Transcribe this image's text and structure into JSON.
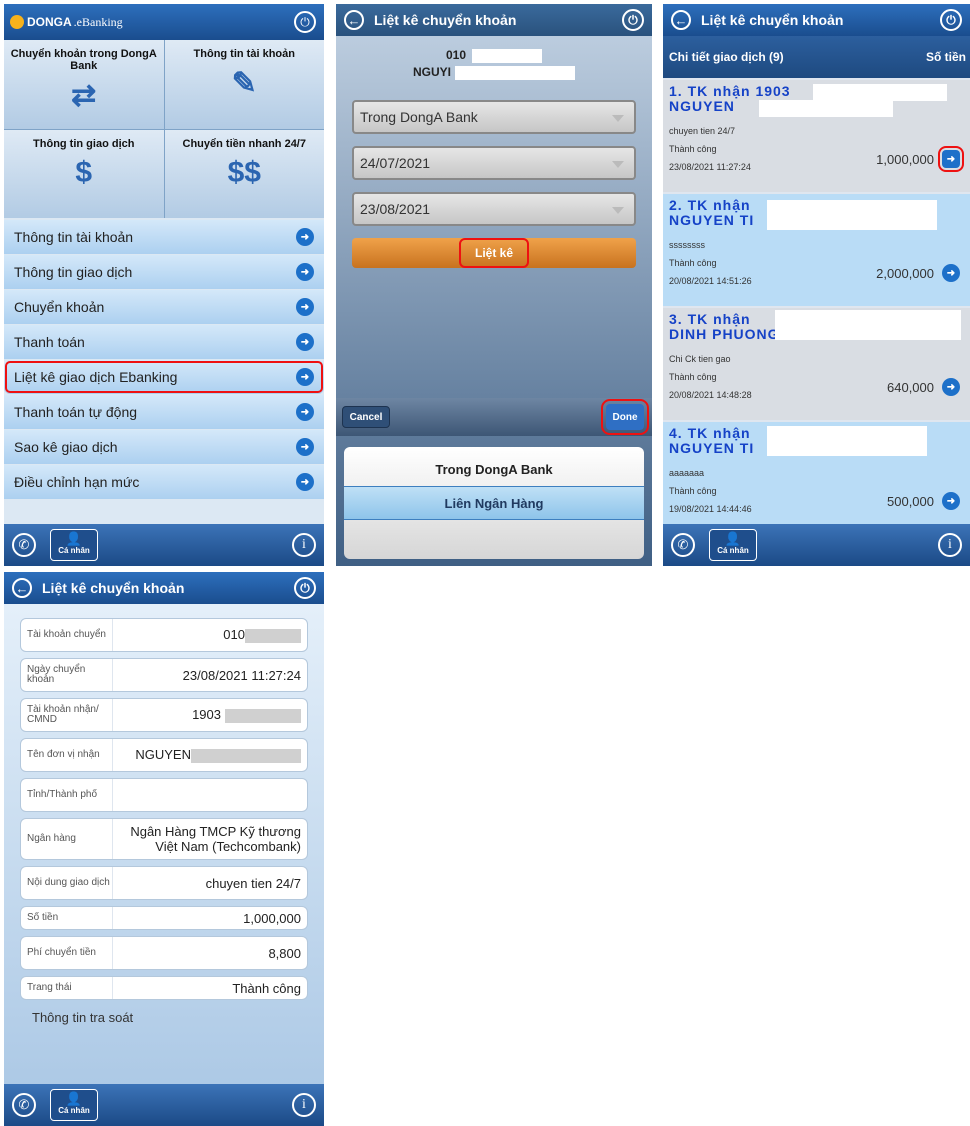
{
  "p1": {
    "brand": "DONGA",
    "brand2": ".eBanking",
    "tiles": [
      "Chuyển khoản trong DongA Bank",
      "Thông tin tài khoản",
      "Thông tin giao dịch",
      "Chuyển tiền nhanh 24/7"
    ],
    "menu": [
      "Thông tin tài khoản",
      "Thông tin giao dịch",
      "Chuyển khoản",
      "Thanh toán",
      "Liệt kê giao dịch Ebanking",
      "Thanh toán tự động",
      "Sao kê giao dịch",
      "Điều chỉnh hạn mức"
    ],
    "footer": {
      "personal": "Cá nhân"
    }
  },
  "p2": {
    "title": "Liệt kê chuyển khoản",
    "acc": "010",
    "name": "NGUYI",
    "select1": "Trong DongA Bank",
    "from": "24/07/2021",
    "to": "23/08/2021",
    "list_btn": "Liệt kê",
    "cancel": "Cancel",
    "done": "Done",
    "options": [
      "Trong DongA Bank",
      "Liên Ngân Hàng",
      ""
    ]
  },
  "p3": {
    "title": "Liệt kê chuyển khoản",
    "detail": "Chi tiết giao dịch (9)",
    "amount_col": "Số tiền",
    "tx": [
      {
        "l1": "1. TK nhận 1903",
        "l2": "NGUYEN",
        "desc": "chuyen tien 24/7",
        "status": "Thành công",
        "time": "23/08/2021 11:27:24",
        "amount": "1,000,000"
      },
      {
        "l1": "2. TK nhận",
        "l2": "NGUYEN TI",
        "desc": "ssssssss",
        "status": "Thành công",
        "time": "20/08/2021 14:51:26",
        "amount": "2,000,000"
      },
      {
        "l1": "3. TK nhận",
        "l2": "DINH PHUONG",
        "desc": "Chi Ck tien gao",
        "status": "Thành công",
        "time": "20/08/2021 14:48:28",
        "amount": "640,000"
      },
      {
        "l1": "4. TK nhận",
        "l2": "NGUYEN TI",
        "desc": "aaaaaaa",
        "status": "Thành công",
        "time": "19/08/2021 14:44:46",
        "amount": "500,000"
      }
    ]
  },
  "p4": {
    "title": "Liệt kê chuyển khoản",
    "rows": [
      {
        "label": "Tài khoản chuyển",
        "value": "010"
      },
      {
        "label": "Ngày chuyển khoản",
        "value": "23/08/2021 11:27:24"
      },
      {
        "label": "Tài khoản nhận/ CMND",
        "value": "1903"
      },
      {
        "label": "Tên đơn vị nhận",
        "value": "NGUYEN"
      },
      {
        "label": "Tỉnh/Thành phố",
        "value": ""
      },
      {
        "label": "Ngân hàng",
        "value": "Ngân Hàng TMCP Kỹ thương Việt Nam (Techcombank)"
      },
      {
        "label": "Nội dung giao dịch",
        "value": "chuyen tien 24/7"
      },
      {
        "label": "Số tiền",
        "value": "1,000,000"
      },
      {
        "label": "Phí chuyển tiền",
        "value": "8,800"
      },
      {
        "label": "Trang thái",
        "value": "Thành công"
      }
    ],
    "tracing": "Thông tin tra soát"
  }
}
